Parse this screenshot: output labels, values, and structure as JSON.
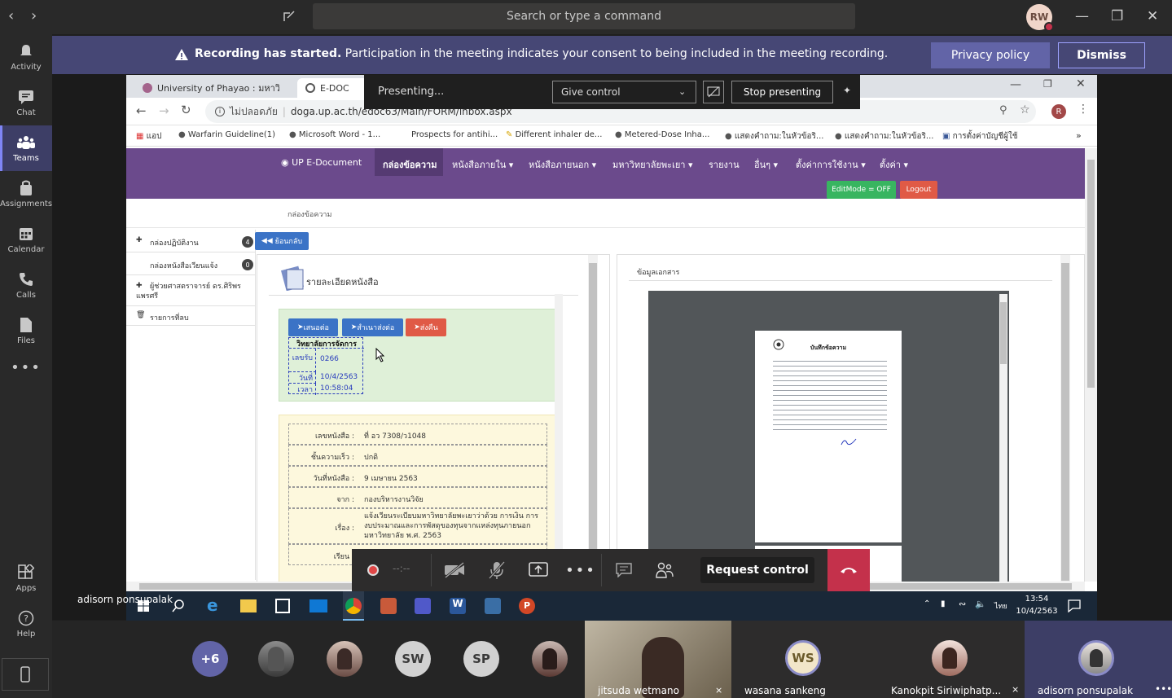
{
  "titlebar": {
    "search_placeholder": "Search or type a command",
    "user_initials": "RW"
  },
  "rail": [
    {
      "label": "Activity",
      "icon": "bell-icon"
    },
    {
      "label": "Chat",
      "icon": "chat-icon"
    },
    {
      "label": "Teams",
      "icon": "teams-icon",
      "active": true
    },
    {
      "label": "Assignments",
      "icon": "assignments-icon"
    },
    {
      "label": "Calendar",
      "icon": "calendar-icon"
    },
    {
      "label": "Calls",
      "icon": "phone-icon"
    },
    {
      "label": "Files",
      "icon": "file-icon"
    },
    {
      "label": "Apps",
      "icon": "apps-icon"
    },
    {
      "label": "Help",
      "icon": "help-icon"
    }
  ],
  "banner": {
    "title": "Recording has started.",
    "message": "Participation in the meeting indicates your consent to being included in the meeting recording.",
    "privacy_label": "Privacy policy",
    "dismiss_label": "Dismiss"
  },
  "sharebar": {
    "status": "Presenting...",
    "give_control": "Give control",
    "stop": "Stop presenting"
  },
  "browser": {
    "tab1": "University of Phayao : มหาวิทยาลั",
    "tab2": "E-DOC",
    "url_secure_label": "ไม่ปลอดภัย",
    "url": "doga.up.ac.th/edoc63/Main/FORM/inbox.aspx",
    "bookmarks": [
      "แอป",
      "Warfarin Guideline(1)",
      "Microsoft Word - 1...",
      "Prospects for antihi...",
      "Different inhaler de...",
      "Metered-Dose Inha...",
      "แสดงคำถาม:ในหัวข้อริ...",
      "แสดงคำถาม:ในหัวข้อริ...",
      "การตั้งค่าบัญชีผู้ใช้"
    ]
  },
  "site": {
    "brand": "UP E-Document",
    "nav": [
      "กล่องข้อความ",
      "หนังสือภายใน",
      "หนังสือภายนอก",
      "มหาวิทยาลัยพะเยา",
      "รายงาน",
      "อื่นๆ",
      "ตั้งค่าการใช้งาน",
      "ตั้งค่า"
    ],
    "editmode": "EditMode = OFF",
    "logout": "Logout",
    "breadcrumb": "กล่องข้อความ",
    "sidebar": [
      {
        "label": "กล่องปฏิบัติงาน",
        "badge": "4"
      },
      {
        "label": "กล่องหนังสือเวียนแจ้ง",
        "badge": "0"
      },
      {
        "label": "ผู้ช่วยศาสตราจารย์ ดร.ศิริพร แพรศรี"
      },
      {
        "label": "รายการที่ลบ"
      }
    ],
    "back": "ย้อนกลับ",
    "detail_title": "รายละเอียดหนังสือ",
    "actions": {
      "forward": "เสนอต่อ",
      "copy": "สำเนาส่งต่อ",
      "return": "ส่งคืน"
    },
    "stamp": {
      "org": "วิทยาลัยการจัดการ",
      "num_label": "เลขรับ",
      "num": "0266",
      "date_label": "วันที่",
      "date": "10/4/2563",
      "time_label": "เวลา",
      "time": "10:58:04"
    },
    "fields": [
      {
        "label": "เลขหนังสือ :",
        "value": "ที่ อว 7308/ว1048"
      },
      {
        "label": "ชั้นความเร็ว :",
        "value": "ปกติ"
      },
      {
        "label": "วันที่หนังสือ :",
        "value": "9 เมษายน 2563"
      },
      {
        "label": "จาก :",
        "value": "กองบริหารงานวิจัย"
      },
      {
        "label": "เรื่อง :",
        "value": "แจ้งเวียนระเบียบมหาวิทยาลัยพะเยาว่าด้วย การเงิน การงบประมาณและการพัสดุของทุนจากแหล่งทุนภายนอกมหาวิทยาลัย พ.ศ. 2563"
      },
      {
        "label": "เรียน :",
        "value": ""
      }
    ],
    "doc_panel_title": "ข้อมูลเอกสาร",
    "memo_title": "บันทึกข้อความ"
  },
  "callbar": {
    "timer": "--:--",
    "request_control": "Request control"
  },
  "taskbar": {
    "user": "adisorn ponsupalak",
    "lang": "ไทย",
    "time": "13:54",
    "date": "10/4/2563"
  },
  "participants": {
    "overflow": "+6",
    "avatars": [
      "SW",
      "SP"
    ],
    "tiles": [
      {
        "name": "jitsuda wetmano"
      },
      {
        "name": "wasana sankeng",
        "initials": "WS"
      },
      {
        "name": "Kanokpit Siriwiphatp..."
      },
      {
        "name": "adisorn ponsupalak"
      }
    ]
  },
  "colors": {
    "teams_purple": "#464775",
    "accent": "#6264a7",
    "site_purple": "#6b4a8c",
    "hangup": "#c4314b"
  }
}
